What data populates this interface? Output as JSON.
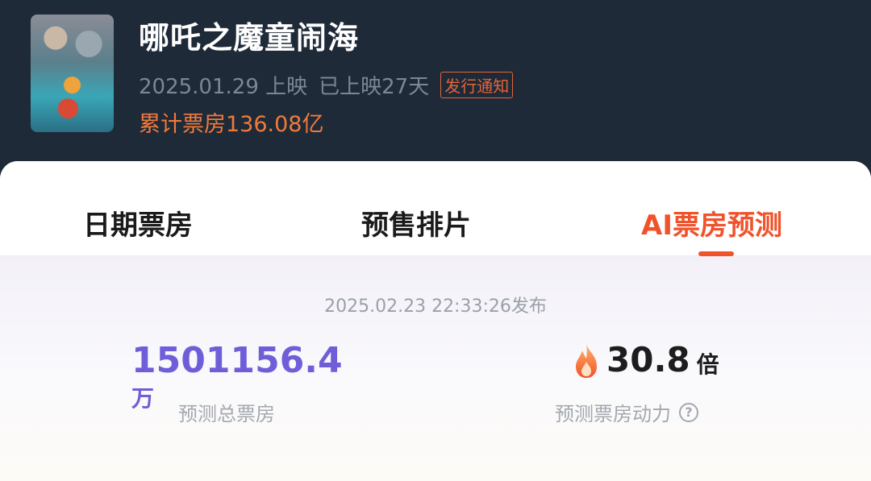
{
  "movie": {
    "title": "哪吒之魔童闹海",
    "release_date": "2025.01.29 上映",
    "days_showing": "已上映27天",
    "notice_tag": "发行通知",
    "box_office_total": "累计票房136.08亿"
  },
  "tabs": [
    {
      "label": "日期票房",
      "active": false
    },
    {
      "label": "预售排片",
      "active": false
    },
    {
      "label": "AI票房预测",
      "active": true
    }
  ],
  "prediction": {
    "published": "2025.02.23 22:33:26发布",
    "total_value": "1501156.4",
    "total_unit": "万",
    "total_label": "预测总票房",
    "power_value": "30.8",
    "power_unit": "倍",
    "power_label": "预测票房动力",
    "help_glyph": "?",
    "icons": {
      "power": "flame-icon",
      "help": "question-circle-icon"
    }
  },
  "colors": {
    "header_bg": "#1f2a38",
    "accent_orange": "#f0532b",
    "box_office_orange": "#f07a3a",
    "prediction_purple": "#6e5fd9"
  }
}
